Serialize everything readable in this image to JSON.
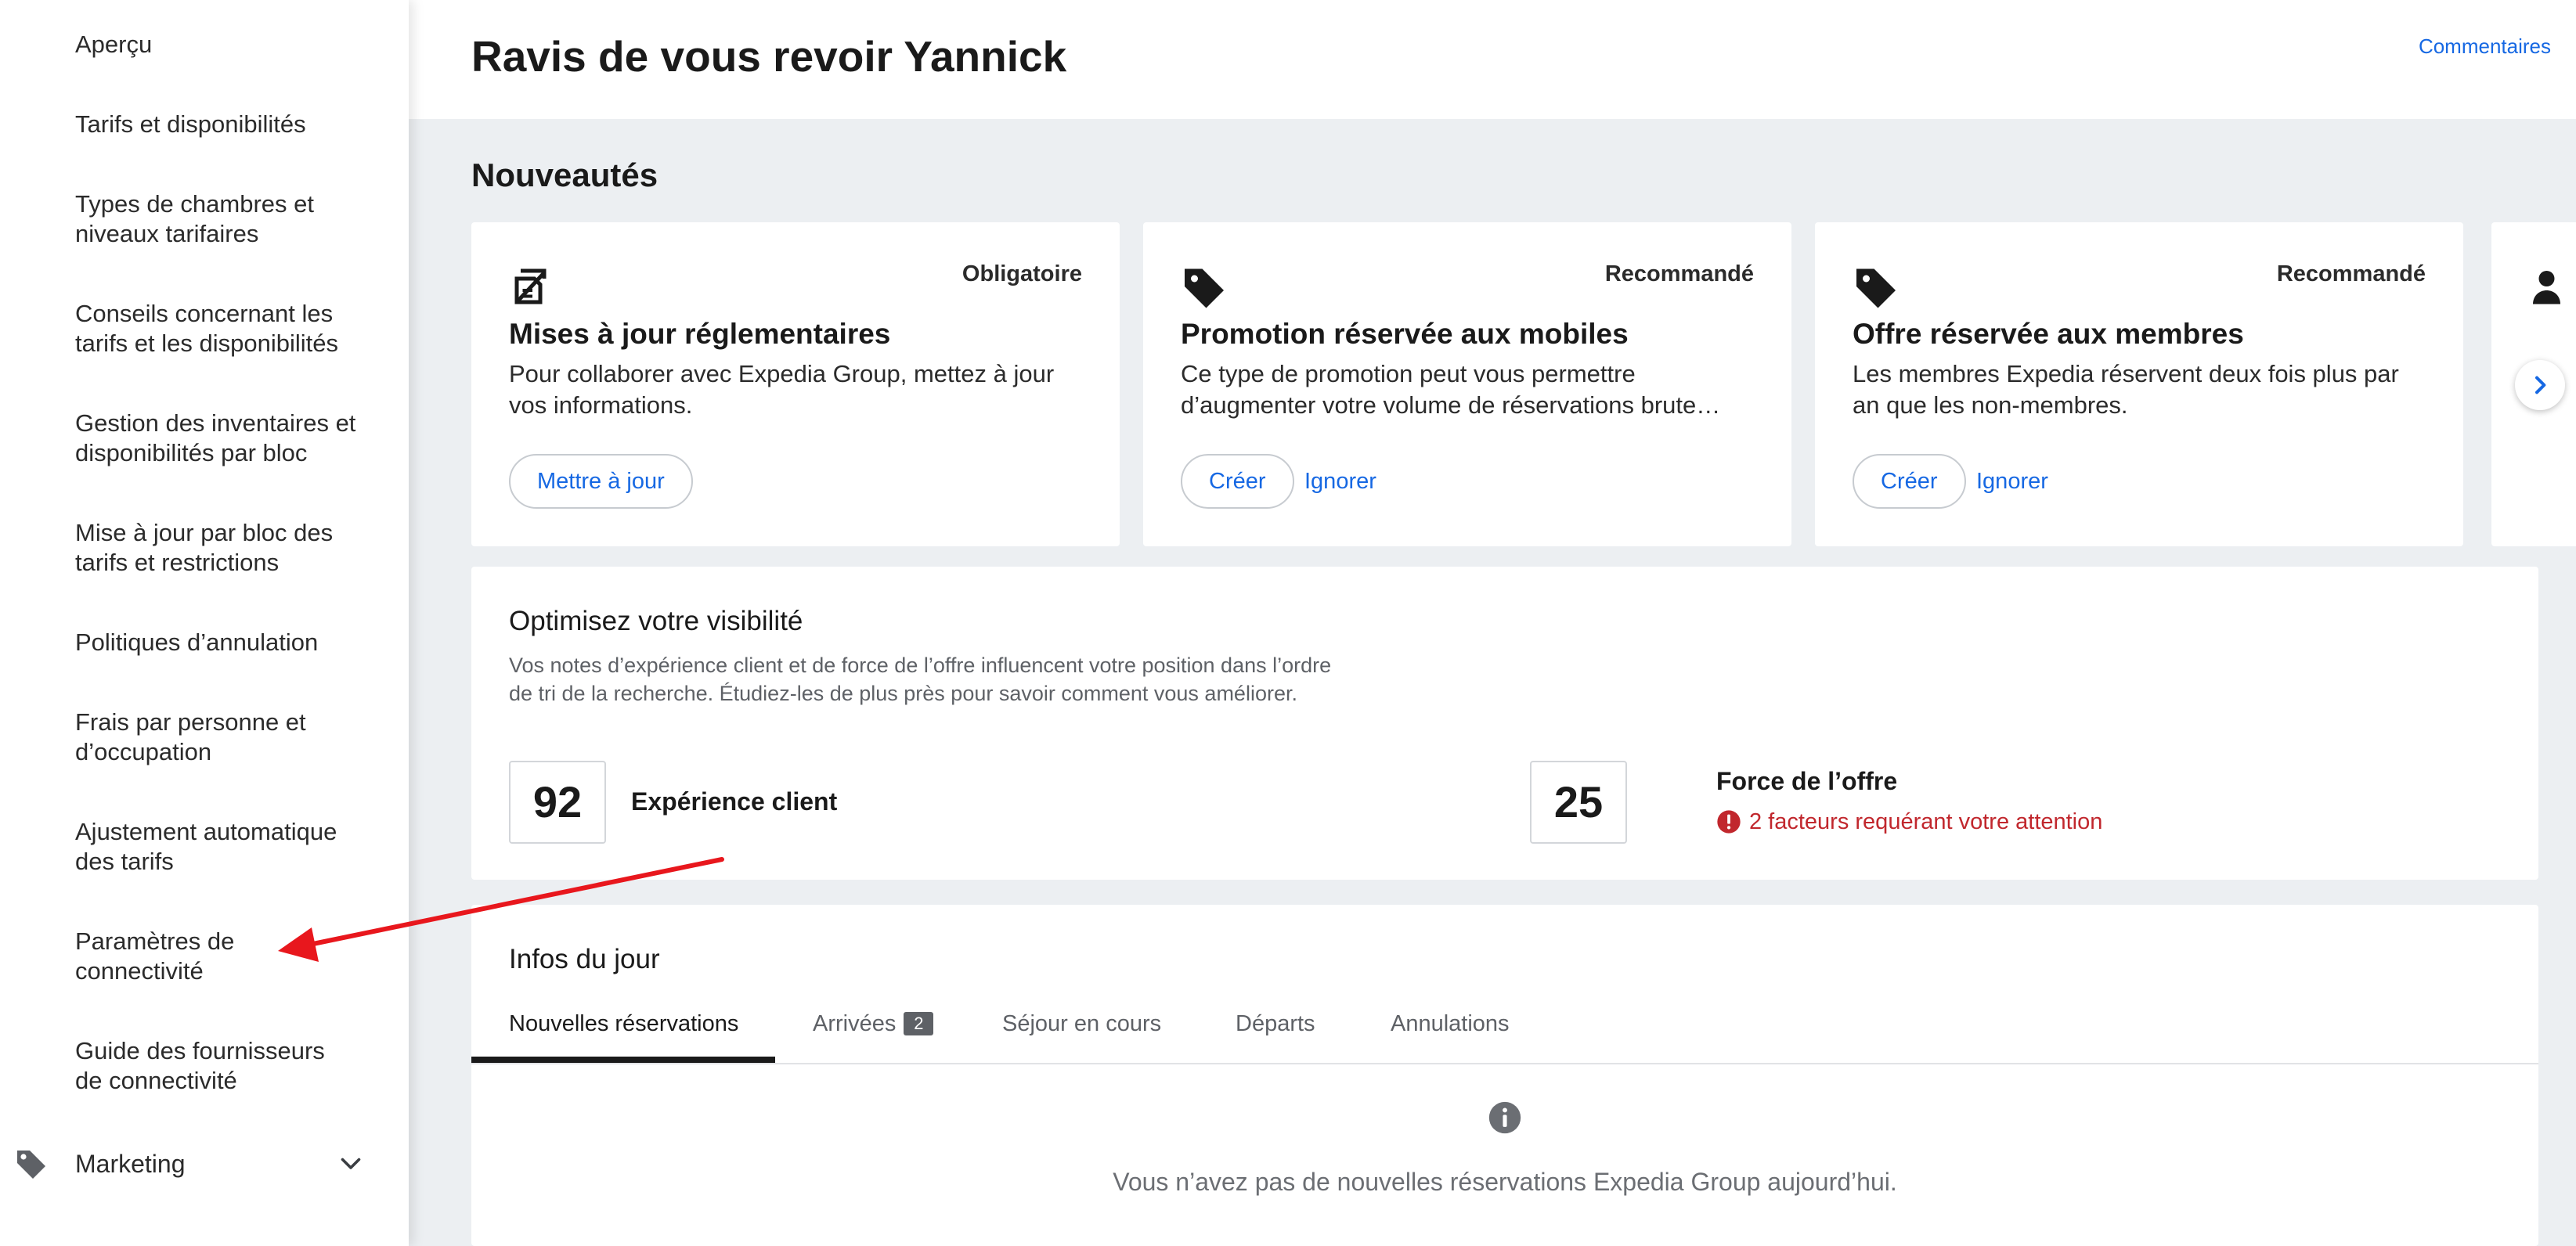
{
  "sidebar": {
    "items": [
      {
        "label": "Aperçu"
      },
      {
        "label": "Tarifs et disponibilités"
      },
      {
        "label": "Types de chambres et niveaux tarifaires"
      },
      {
        "label": "Conseils concernant les tarifs et les disponibilités"
      },
      {
        "label": "Gestion des inventaires et disponibilités par bloc"
      },
      {
        "label": "Mise à jour par bloc des tarifs et restrictions"
      },
      {
        "label": "Politiques d’annulation"
      },
      {
        "label": "Frais par personne et d’occupation"
      },
      {
        "label": "Ajustement automatique des tarifs"
      },
      {
        "label": "Paramètres de connectivité"
      },
      {
        "label": "Guide des fournisseurs de connectivité"
      }
    ],
    "marketing": {
      "label": "Marketing",
      "icon": "tag-icon",
      "chevron": "chevron-down-icon"
    }
  },
  "header": {
    "title": "Ravis de vous revoir Yannick",
    "feedback_link": "Commentaires"
  },
  "news": {
    "title": "Nouveautés",
    "cards": [
      {
        "badge": "Obligatoire",
        "icon": "regulatory-document-icon",
        "title": "Mises à jour réglementaires",
        "description": "Pour collaborer avec Expedia Group, mettez à jour vos informations.",
        "primary": "Mettre à jour"
      },
      {
        "badge": "Recommandé",
        "icon": "tag-icon",
        "title": "Promotion réservée aux mobiles",
        "description": "Ce type de promotion peut vous permettre d’augmenter votre volume de réservations brute…",
        "primary": "Créer",
        "secondary": "Ignorer"
      },
      {
        "badge": "Recommandé",
        "icon": "tag-icon",
        "title": "Offre réservée aux membres",
        "description": "Les membres Expedia réservent deux fois plus par an que les non-membres.",
        "primary": "Créer",
        "secondary": "Ignorer"
      }
    ],
    "next_icon": "chevron-right-icon"
  },
  "visibility": {
    "title": "Optimisez votre visibilité",
    "description": "Vos notes d’expérience client et de force de l’offre influencent votre position dans l’ordre de tri de la recherche. Étudiez-les de plus près pour savoir comment vous améliorer.",
    "guest_experience": {
      "score": "92",
      "label": "Expérience client"
    },
    "offer_strength": {
      "score": "25",
      "label": "Force de l’offre",
      "warning": "2 facteurs requérant votre attention"
    },
    "warning_color": "#c1272d"
  },
  "today": {
    "title": "Infos du jour",
    "tabs": [
      {
        "label": "Nouvelles réservations",
        "active": true
      },
      {
        "label": "Arrivées",
        "count": "2"
      },
      {
        "label": "Séjour en cours"
      },
      {
        "label": "Départs"
      },
      {
        "label": "Annulations"
      }
    ],
    "empty_message": "Vous n’avez pas de nouvelles réservations Expedia Group aujourd’hui."
  },
  "colors": {
    "accent": "#1668e3",
    "annotation_arrow": "#e8171d",
    "page_background": "#eceff2"
  }
}
